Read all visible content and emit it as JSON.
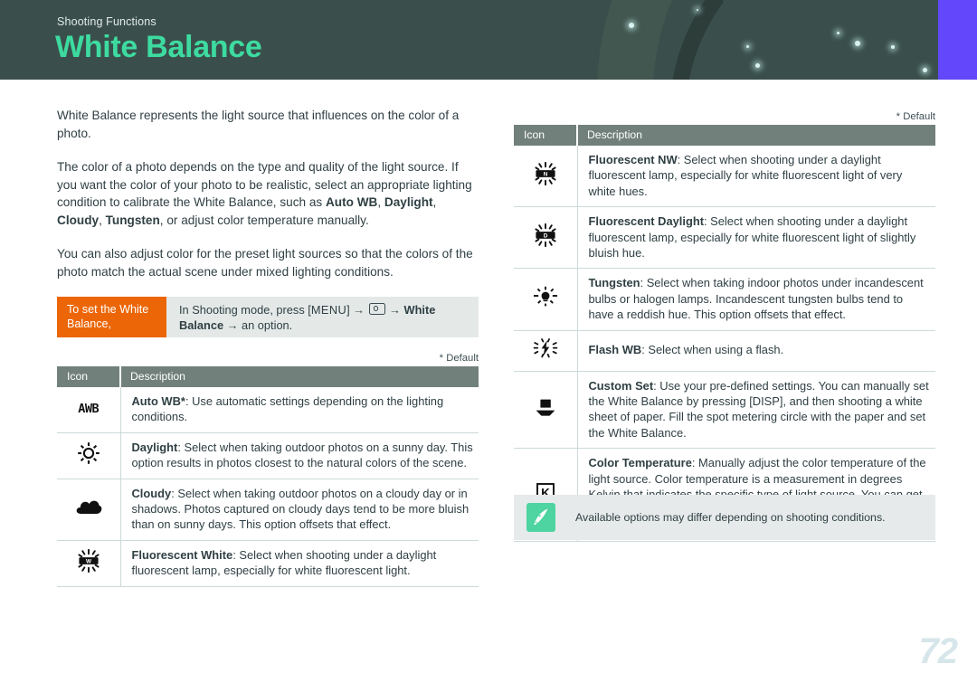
{
  "header": {
    "kicker": "Shooting Functions",
    "title": "White Balance",
    "bg_color": "#3a4f4b",
    "title_color": "#3ddba0",
    "accent_bar_color": "#6347fb"
  },
  "intro": {
    "paragraph1": "White Balance represents the light source that influences on the color of a photo.",
    "paragraph2_part1": "The color of a photo depends on the type and quality of the light source. If you want the color of your photo to be realistic, select an appropriate lighting condition to calibrate the White Balance, such as ",
    "paragraph2_bold1": "Auto WB",
    "paragraph2_sep1": ", ",
    "paragraph2_bold2": "Daylight",
    "paragraph2_sep2": ", ",
    "paragraph2_bold3": "Cloudy",
    "paragraph2_sep3": ", ",
    "paragraph2_bold4": "Tungsten",
    "paragraph2_part2": ", or adjust color temperature manually.",
    "paragraph3": "You can also adjust color for the preset light sources so that the colors of the photo match the actual scene under mixed lighting conditions."
  },
  "callout": {
    "tag": "To set the White Balance,",
    "step_prefix": "In Shooting mode, press [",
    "key_menu": "MENU",
    "step_after_menu": "] ",
    "arrow": "→",
    "camera_icon": "camera-mode-icon",
    "target_bold": "White Balance",
    "step_end": "an option."
  },
  "left_table": {
    "default_note": "* Default",
    "columns": [
      "Icon",
      "Description"
    ],
    "rows": [
      {
        "icon": "awb-icon",
        "icon_text": "AWB",
        "label": "Auto WB*",
        "desc": ": Use automatic settings depending on the lighting conditions."
      },
      {
        "icon": "sun-icon",
        "label": "Daylight",
        "desc": ": Select when taking outdoor photos on a sunny day. This option results in photos closest to the natural colors of the scene."
      },
      {
        "icon": "cloud-icon",
        "label": "Cloudy",
        "desc": ": Select when taking outdoor photos on a cloudy day or in shadows. Photos captured on cloudy days tend to be more bluish than on sunny days. This option offsets that effect."
      },
      {
        "icon": "fluorescent-white-icon",
        "icon_letter": "W",
        "label": "Fluorescent White",
        "desc": ": Select when shooting under a daylight fluorescent lamp, especially for white fluorescent light."
      }
    ]
  },
  "right_table": {
    "default_note": "* Default",
    "columns": [
      "Icon",
      "Description"
    ],
    "rows": [
      {
        "icon": "fluorescent-nw-icon",
        "icon_letter": "N",
        "label": "Fluorescent NW",
        "desc": ": Select when shooting under a daylight fluorescent lamp, especially for white fluorescent light of very white hues."
      },
      {
        "icon": "fluorescent-daylight-icon",
        "icon_letter": "D",
        "label": "Fluorescent Daylight",
        "desc": ": Select when shooting under a daylight fluorescent lamp, especially for white fluorescent light of slightly bluish hue."
      },
      {
        "icon": "tungsten-icon",
        "label": "Tungsten",
        "desc": ": Select when taking indoor photos under incandescent bulbs or halogen lamps. Incandescent tungsten bulbs tend to have a reddish hue. This option offsets that effect."
      },
      {
        "icon": "flash-icon",
        "label": "Flash WB",
        "desc": ": Select when using a flash."
      },
      {
        "icon": "custom-set-icon",
        "label": "Custom Set",
        "desc": ": Use your pre-defined settings. You can manually set the White Balance by pressing [DISP], and then shooting a white sheet of paper. Fill the spot metering circle with the paper and set the White Balance."
      },
      {
        "icon": "kelvin-icon",
        "icon_text": "K",
        "label": "Color Temperature",
        "desc": ": Manually adjust the color temperature of the light source. Color temperature is a measurement in degrees Kelvin that indicates the specific type of light source. You can get a warmer photo with a higher value, and a cooler photo with a lower value. Press [DISP], and then adjust the color temperature."
      }
    ]
  },
  "info_note": {
    "icon": "pen-note-icon",
    "text": "Available options may differ depending on shooting conditions.",
    "badge_color": "#4dd4a0"
  },
  "page_number": "72"
}
